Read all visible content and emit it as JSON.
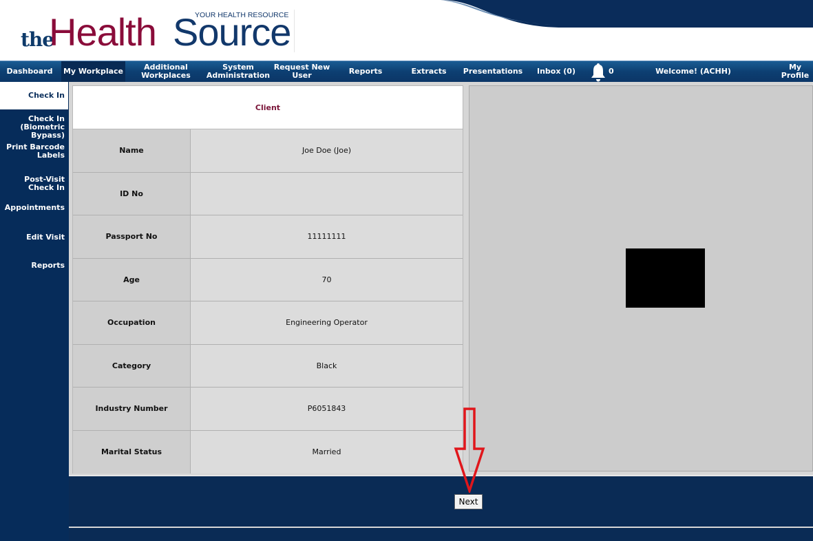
{
  "header": {
    "logo_the": "the",
    "logo_health": "Health",
    "logo_source": "Source",
    "logo_tagline": "YOUR HEALTH RESOURCE"
  },
  "nav": {
    "items": [
      {
        "label": "Dashboard"
      },
      {
        "label": "My Workplace"
      },
      {
        "label": "Additional\nWorkplaces"
      },
      {
        "label": "System\nAdministration"
      },
      {
        "label": "Request New\nUser"
      },
      {
        "label": "Reports"
      },
      {
        "label": "Extracts"
      },
      {
        "label": "Presentations"
      },
      {
        "label": "Inbox (0)"
      },
      {
        "label": "Welcome! (ACHH)"
      },
      {
        "label": "My Profile"
      }
    ],
    "notification_count": "0",
    "active_index": 1
  },
  "sidebar": {
    "items": [
      {
        "label": "Check In"
      },
      {
        "label": "Check In\n(Biometric Bypass)"
      },
      {
        "label": "Print Barcode\nLabels"
      },
      {
        "label": "Post-Visit Check In"
      },
      {
        "label": "Appointments"
      },
      {
        "label": "Edit Visit"
      },
      {
        "label": "Reports"
      }
    ],
    "active_index": 0
  },
  "client": {
    "heading": "Client",
    "rows": [
      {
        "label": "Name",
        "value": "Joe Doe (Joe)"
      },
      {
        "label": "ID No",
        "value": ""
      },
      {
        "label": "Passport No",
        "value": "11111111"
      },
      {
        "label": "Age",
        "value": "70"
      },
      {
        "label": "Occupation",
        "value": "Engineering Operator"
      },
      {
        "label": "Category",
        "value": "Black"
      },
      {
        "label": "Industry Number",
        "value": "P6051843"
      },
      {
        "label": "Marital Status",
        "value": "Married"
      }
    ]
  },
  "footer": {
    "next_label": "Next"
  },
  "colors": {
    "brand_navy": "#062c5a",
    "brand_maroon": "#8a0c3a",
    "annotation_red": "#e0161b"
  }
}
